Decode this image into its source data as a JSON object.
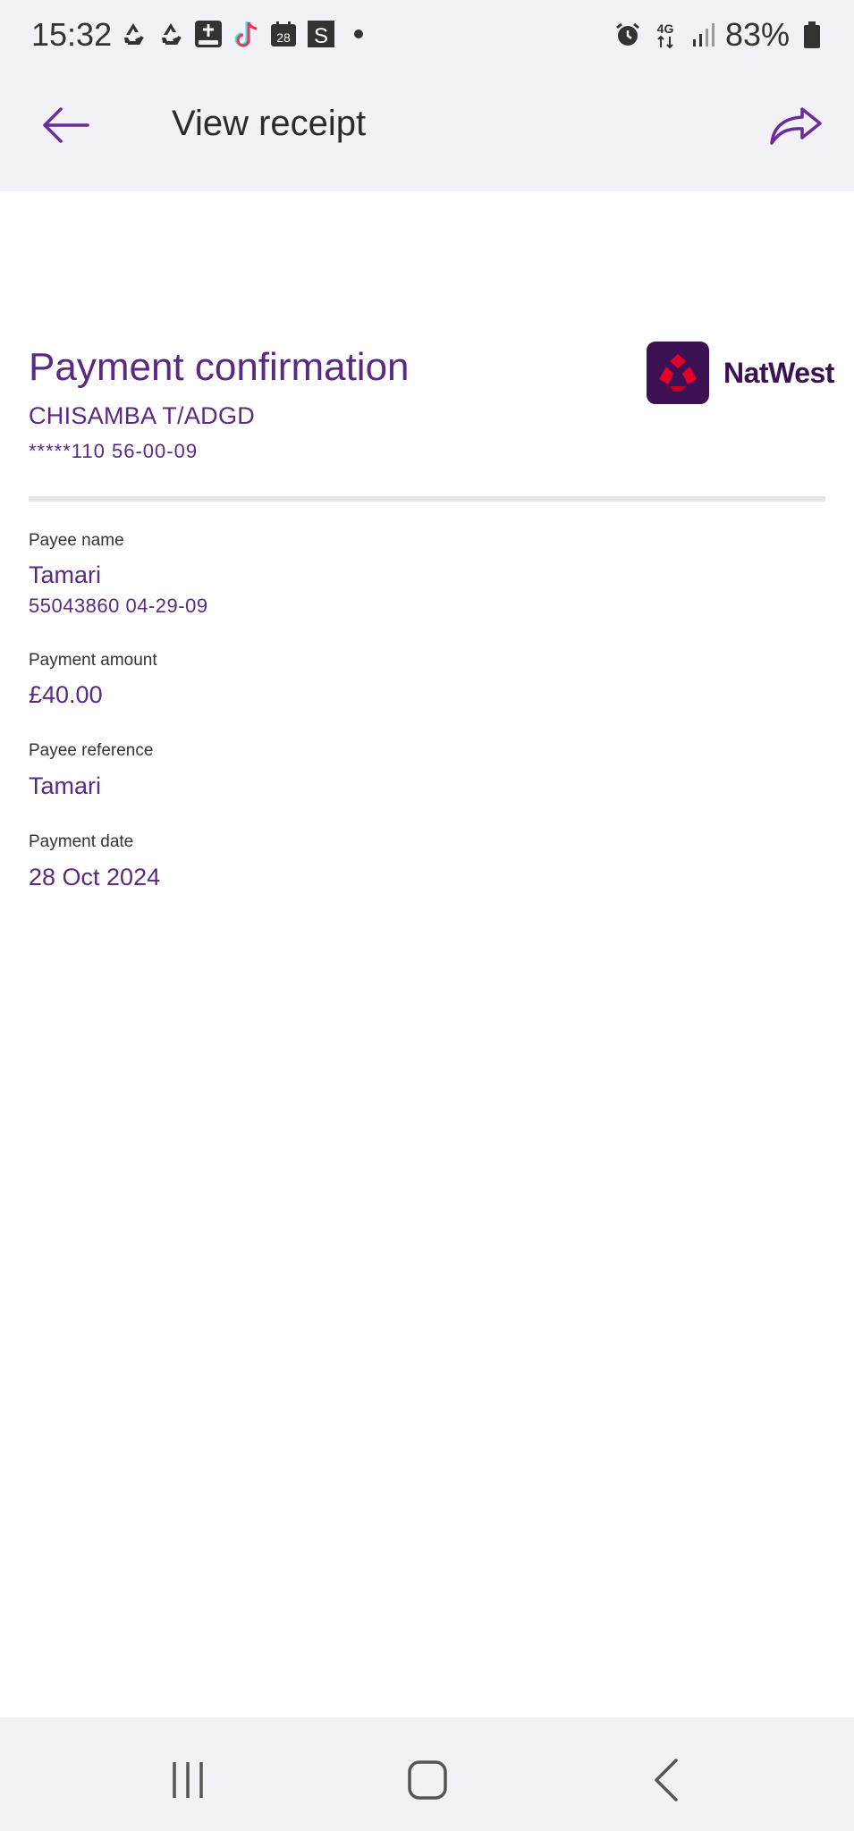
{
  "status_bar": {
    "time": "15:32",
    "battery": "83%",
    "icons": [
      "recycle-icon",
      "recycle-icon",
      "plus-box-icon",
      "tiktok-icon",
      "calendar-28-icon",
      "s-app-icon",
      "dot-icon",
      "alarm-icon",
      "4g-icon",
      "signal-icon",
      "battery-icon"
    ],
    "calendar_day": "28",
    "s_app_letter": "S",
    "network": "4G"
  },
  "app_bar": {
    "title": "View receipt"
  },
  "receipt": {
    "title": "Payment confirmation",
    "account_name": "CHISAMBA T/ADGD",
    "account_number": "*****110 56-00-09",
    "brand": "NatWest",
    "fields": [
      {
        "label": "Payee name",
        "value": "Tamari",
        "sub": "55043860 04-29-09"
      },
      {
        "label": "Payment amount",
        "value": "£40.00"
      },
      {
        "label": "Payee reference",
        "value": "Tamari"
      },
      {
        "label": "Payment date",
        "value": "28 Oct 2024"
      }
    ]
  },
  "colors": {
    "accent": "#5a2a82",
    "brand": "#3c1053",
    "logo_red": "#e4002b",
    "bar_bg": "#f1f1f6"
  }
}
